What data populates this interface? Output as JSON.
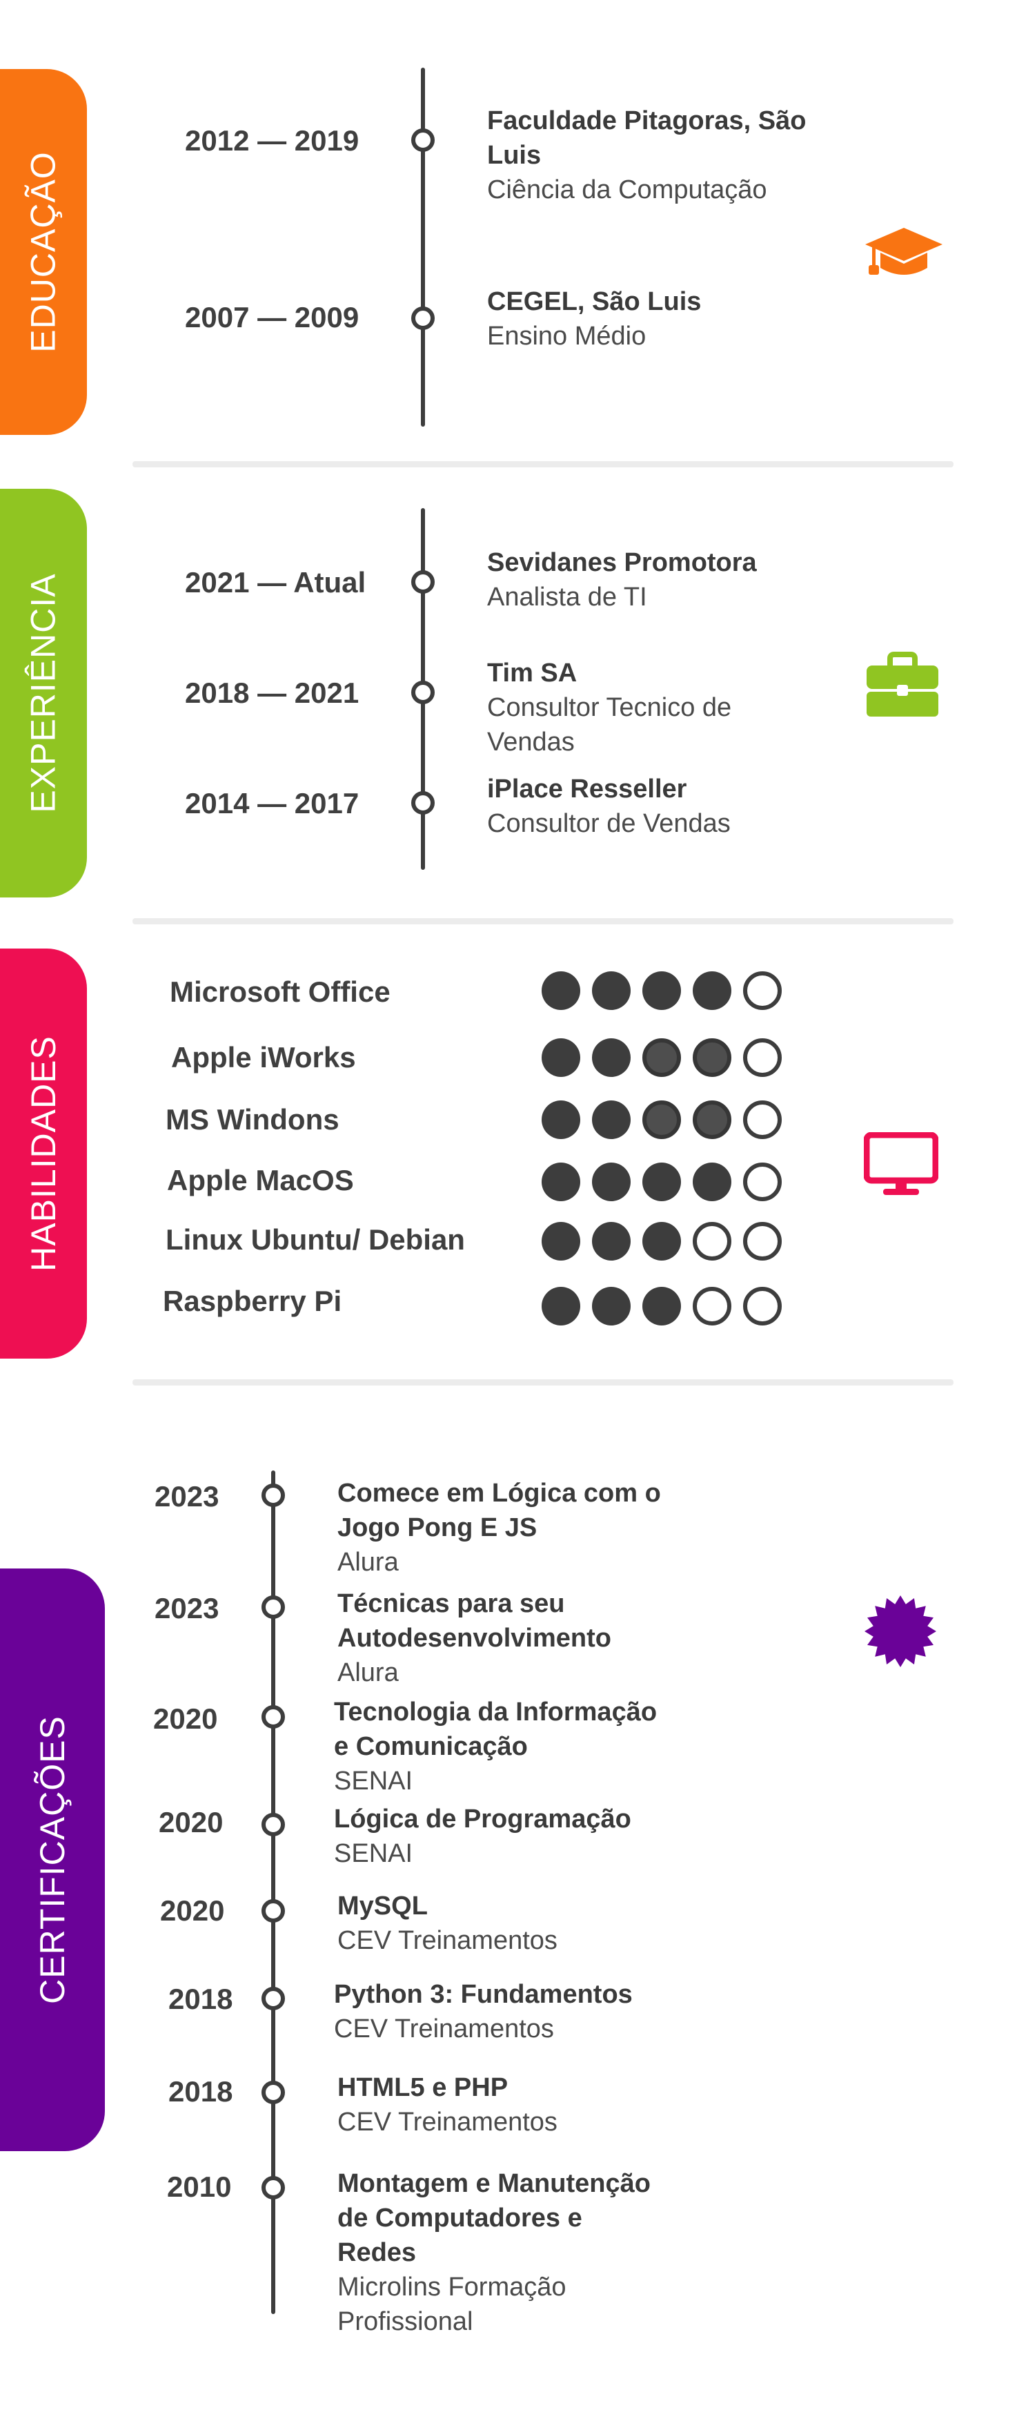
{
  "colors": {
    "educacao": "#f97412",
    "experiencia": "#90c522",
    "habilidades": "#ee0f52",
    "certificacoes": "#6a0298",
    "ink": "#3d3d3d"
  },
  "educacao": {
    "label": "EDUCAÇÃO",
    "icon": "graduation-cap-icon",
    "items": [
      {
        "years": "2012 — 2019",
        "title_l1": "Faculdade Pitagoras, São",
        "title_l2": "Luis",
        "sub": "Ciência da Computação"
      },
      {
        "years": "2007 — 2009",
        "title_l1": "CEGEL, São Luis",
        "sub": "Ensino Médio"
      }
    ]
  },
  "experiencia": {
    "label": "EXPERIÊNCIA",
    "icon": "briefcase-icon",
    "items": [
      {
        "years": "2021 — Atual",
        "title": "Sevidanes Promotora",
        "sub": "Analista de TI"
      },
      {
        "years": "2018 — 2021",
        "title": "Tim SA",
        "sub_l1": "Consultor Tecnico de",
        "sub_l2": "Vendas"
      },
      {
        "years": "2014 — 2017",
        "title": "iPlace Resseller",
        "sub": "Consultor de Vendas"
      }
    ]
  },
  "habilidades": {
    "label": "HABILIDADES",
    "icon": "monitor-icon",
    "items": [
      {
        "name": "Microsoft Office",
        "rating": [
          1,
          1,
          1,
          1,
          0
        ]
      },
      {
        "name": "Apple iWorks",
        "rating": [
          1,
          1,
          0.5,
          0.5,
          0
        ]
      },
      {
        "name": "MS Windons",
        "rating": [
          1,
          1,
          0.5,
          0.5,
          0
        ]
      },
      {
        "name": "Apple MacOS",
        "rating": [
          1,
          1,
          1,
          1,
          0
        ]
      },
      {
        "name": "Linux Ubuntu/ Debian",
        "rating": [
          1,
          1,
          1,
          0,
          0
        ]
      },
      {
        "name": "Raspberry Pi",
        "rating": [
          1,
          1,
          1,
          0,
          0
        ]
      }
    ]
  },
  "certificacoes": {
    "label": "CERTIFICAÇÕES",
    "icon": "badge-seal-icon",
    "items": [
      {
        "year": "2023",
        "title_l1": "Comece em Lógica com o",
        "title_l2": "Jogo Pong E JS",
        "sub": "Alura"
      },
      {
        "year": "2023",
        "title_l1": "Técnicas para seu",
        "title_l2": "Autodesenvolvimento",
        "sub": "Alura"
      },
      {
        "year": "2020",
        "title_l1": "Tecnologia da Informação",
        "title_l2": "e Comunicação",
        "sub": "SENAI"
      },
      {
        "year": "2020",
        "title_l1": "Lógica de Programação",
        "sub": "SENAI"
      },
      {
        "year": "2020",
        "title_l1": "MySQL",
        "sub": "CEV Treinamentos"
      },
      {
        "year": "2018",
        "title_l1": "Python 3: Fundamentos",
        "sub": "CEV Treinamentos"
      },
      {
        "year": "2018",
        "title_l1": "HTML5 e PHP",
        "sub": "CEV Treinamentos"
      },
      {
        "year": "2010",
        "title_l1": "Montagem e Manutenção",
        "title_l2": "de Computadores e",
        "title_l3": "Redes",
        "sub_l1": "Microlins Formação",
        "sub_l2": "Profissional"
      }
    ]
  }
}
